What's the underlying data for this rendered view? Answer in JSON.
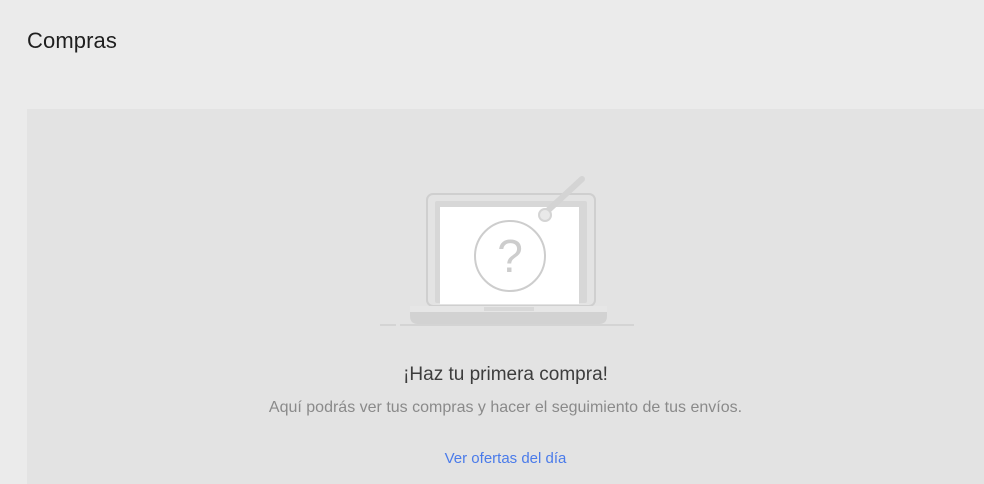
{
  "header": {
    "title": "Compras"
  },
  "empty_state": {
    "illustration_icon": "laptop-question-icon",
    "title": "¡Haz tu primera compra!",
    "subtitle": "Aquí podrás ver tus compras y hacer el seguimiento de tus envíos.",
    "link_label": "Ver ofertas del día"
  },
  "colors": {
    "page_background": "#ebebeb",
    "card_background": "#e3e3e3",
    "link": "#4a7bea"
  }
}
